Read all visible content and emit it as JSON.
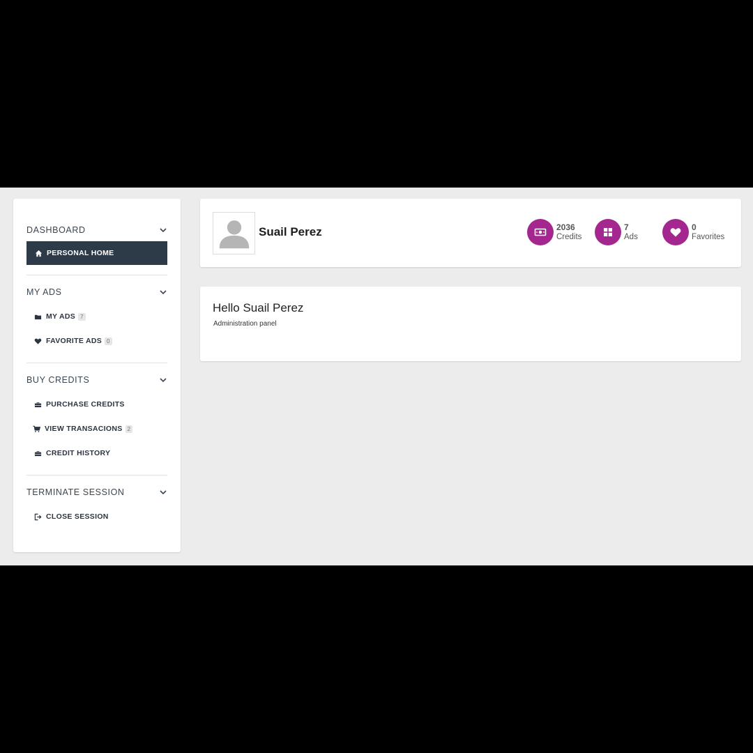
{
  "sidebar": {
    "sections": [
      {
        "title": "DASHBOARD",
        "items": [
          {
            "label": "PERSONAL HOME",
            "icon": "home-icon",
            "active": true
          }
        ]
      },
      {
        "title": "MY ADS",
        "items": [
          {
            "label": "MY ADS",
            "icon": "folder-icon",
            "badge": "7"
          },
          {
            "label": "FAVORITE ADS",
            "icon": "heart-icon",
            "badge": "0"
          }
        ]
      },
      {
        "title": "BUY CREDITS",
        "items": [
          {
            "label": "PURCHASE CREDITS",
            "icon": "briefcase-icon"
          },
          {
            "label": "VIEW TRANSACIONS",
            "icon": "cart-icon",
            "badge": "2"
          },
          {
            "label": "CREDIT HISTORY",
            "icon": "briefcase-icon"
          }
        ]
      },
      {
        "title": "TERMINATE SESSION",
        "items": [
          {
            "label": "CLOSE SESSION",
            "icon": "sign-out-icon"
          }
        ]
      }
    ]
  },
  "profile": {
    "name": "Suail Perez",
    "stats": [
      {
        "value": "2036",
        "label": "Credits",
        "icon": "money-icon"
      },
      {
        "value": "7",
        "label": "Ads",
        "icon": "grid-icon"
      },
      {
        "value": "0",
        "label": "Favorites",
        "icon": "heart-icon"
      }
    ]
  },
  "welcome": {
    "greeting": "Hello Suail Perez",
    "subtitle": "Administration panel"
  },
  "colors": {
    "accent": "#a3278f",
    "active_nav": "#2d3a48",
    "background": "#ececec"
  }
}
